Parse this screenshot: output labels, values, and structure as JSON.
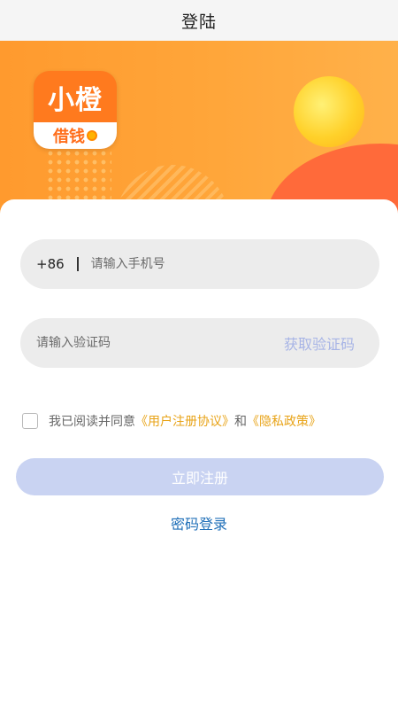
{
  "header": {
    "title": "登陆"
  },
  "logo": {
    "top_text": "小橙",
    "bottom_text": "借钱"
  },
  "form": {
    "country_code": "+86",
    "phone_placeholder": "请输入手机号",
    "code_placeholder": "请输入验证码",
    "get_code_label": "获取验证码"
  },
  "agreement": {
    "prefix": "我已阅读并同意",
    "user_agreement": "《用户注册协议》",
    "and": "和",
    "privacy_policy": "《隐私政策》"
  },
  "actions": {
    "register_label": "立即注册",
    "password_login_label": "密码登录"
  },
  "colors": {
    "banner": "#ffa63a",
    "register_button": "#c9d3f2",
    "get_code": "#a7b4e6",
    "link": "#e8a317",
    "password_login": "#1f6fb8"
  }
}
